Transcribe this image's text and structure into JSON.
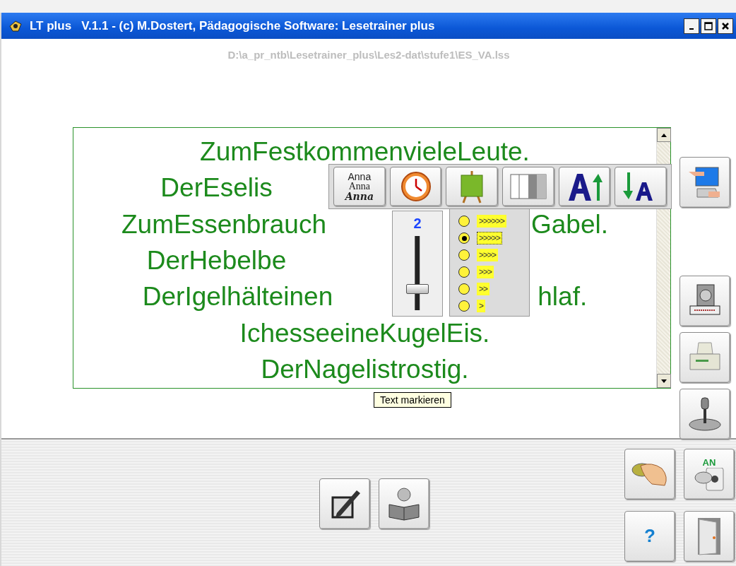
{
  "window": {
    "title": "LT plus   V.1.1 - (c) M.Dostert, Pädagogische Software: Lesetrainer plus"
  },
  "file_path": "D:\\a_pr_ntb\\Lesetrainer_plus\\Les2-dat\\stufe1\\ES_VA.lss",
  "reading_text": {
    "lines": [
      {
        "parts": [
          "ZumFestkommenvieleLeute."
        ]
      },
      {
        "parts": [
          "DerEselis"
        ]
      },
      {
        "parts": [
          "ZumEssenbrauch",
          "Gabel."
        ]
      },
      {
        "parts": [
          "DerHebelbe"
        ]
      },
      {
        "parts": [
          "DerIgelhälteinen",
          "hlaf."
        ]
      },
      {
        "parts": [
          "IchesseeineKugelEis."
        ]
      },
      {
        "parts": [
          "DerNagelistrostig."
        ]
      }
    ]
  },
  "toolbar": {
    "buttons": [
      {
        "kind": "font",
        "samples": [
          "Anna",
          "Anna",
          "Anna"
        ]
      },
      {
        "kind": "clock"
      },
      {
        "kind": "easel"
      },
      {
        "kind": "columns"
      },
      {
        "kind": "grow"
      },
      {
        "kind": "shrink"
      }
    ]
  },
  "speed": {
    "value": "2",
    "level": 0.25
  },
  "speed_options": [
    {
      "label": ">>>>>>",
      "selected": false
    },
    {
      "label": ">>>>>",
      "selected": true
    },
    {
      "label": ">>>>",
      "selected": false
    },
    {
      "label": ">>>",
      "selected": false
    },
    {
      "label": ">>",
      "selected": false
    },
    {
      "label": ">",
      "selected": false
    }
  ],
  "tooltip": "Text markieren",
  "side_buttons": [
    {
      "kind": "pointer"
    },
    {
      "kind": "speaker"
    },
    {
      "kind": "printer"
    },
    {
      "kind": "joystick"
    }
  ],
  "bottom_buttons": [
    {
      "kind": "edit"
    },
    {
      "kind": "reader"
    }
  ],
  "corner_buttons": [
    {
      "kind": "mouse"
    },
    {
      "kind": "switch",
      "label": "AN"
    },
    {
      "kind": "help",
      "label": "?"
    },
    {
      "kind": "door"
    }
  ]
}
